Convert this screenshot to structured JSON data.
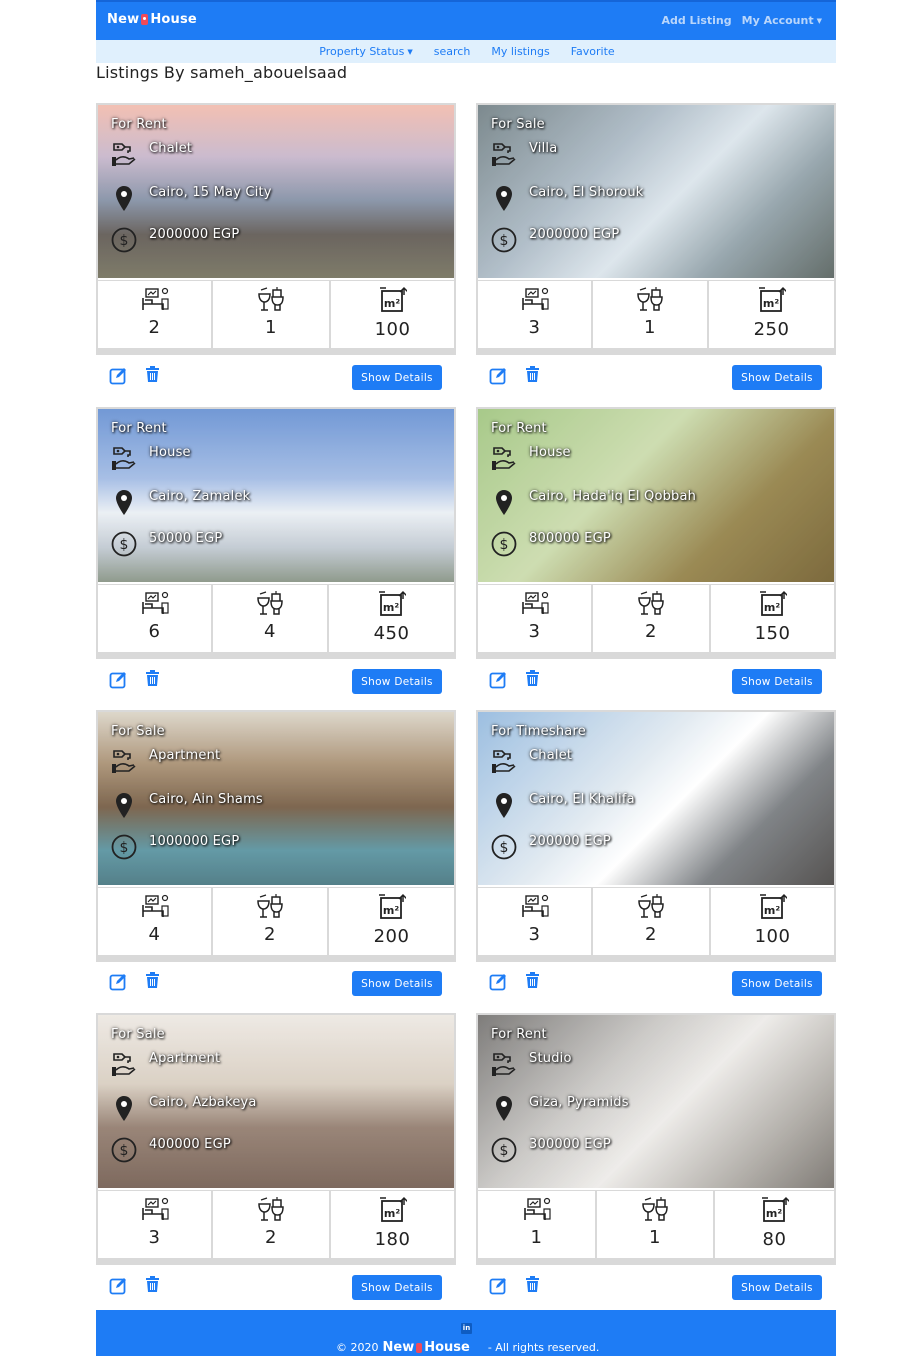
{
  "header": {
    "brand_left": "New",
    "brand_right": "House",
    "add_listing": "Add Listing",
    "my_account": "My Account"
  },
  "subnav": {
    "items": [
      "Property Status",
      "search",
      "My listings",
      "Favorite"
    ]
  },
  "page": {
    "title": "Listings By sameh_abouelsaad"
  },
  "listings": [
    {
      "status": "For Rent",
      "type": "Chalet",
      "location": "Cairo, 15 May City",
      "price": "2000000 EGP",
      "bedrooms": "2",
      "bathrooms": "1",
      "area": "100"
    },
    {
      "status": "For Sale",
      "type": "Villa",
      "location": "Cairo, El Shorouk",
      "price": "2000000 EGP",
      "bedrooms": "3",
      "bathrooms": "1",
      "area": "250"
    },
    {
      "status": "For Rent",
      "type": "House",
      "location": "Cairo, Zamalek",
      "price": "50000 EGP",
      "bedrooms": "6",
      "bathrooms": "4",
      "area": "450"
    },
    {
      "status": "For Rent",
      "type": "House",
      "location": "Cairo, Hada'iq El Qobbah",
      "price": "800000 EGP",
      "bedrooms": "3",
      "bathrooms": "2",
      "area": "150"
    },
    {
      "status": "For Sale",
      "type": "Apartment",
      "location": "Cairo, Ain Shams",
      "price": "1000000 EGP",
      "bedrooms": "4",
      "bathrooms": "2",
      "area": "200"
    },
    {
      "status": "For Timeshare",
      "type": "Chalet",
      "location": "Cairo, El Khalifa",
      "price": "200000 EGP",
      "bedrooms": "3",
      "bathrooms": "2",
      "area": "100"
    },
    {
      "status": "For Sale",
      "type": "Apartment",
      "location": "Cairo, Azbakeya",
      "price": "400000 EGP",
      "bedrooms": "3",
      "bathrooms": "2",
      "area": "180"
    },
    {
      "status": "For Rent",
      "type": "Studio",
      "location": "Giza, Pyramids",
      "price": "300000 EGP",
      "bedrooms": "1",
      "bathrooms": "1",
      "area": "80"
    }
  ],
  "actions": {
    "details_label": "Show Details"
  },
  "footer": {
    "copyright": "© 2020",
    "brand_left": "New",
    "brand_right": "House",
    "rights": "- All rights reserved.",
    "linkedin": "in"
  },
  "colors": {
    "primary": "#1e7cf5",
    "subnav_bg": "#e0f0fd",
    "brand_pin": "#ef4a5a"
  }
}
